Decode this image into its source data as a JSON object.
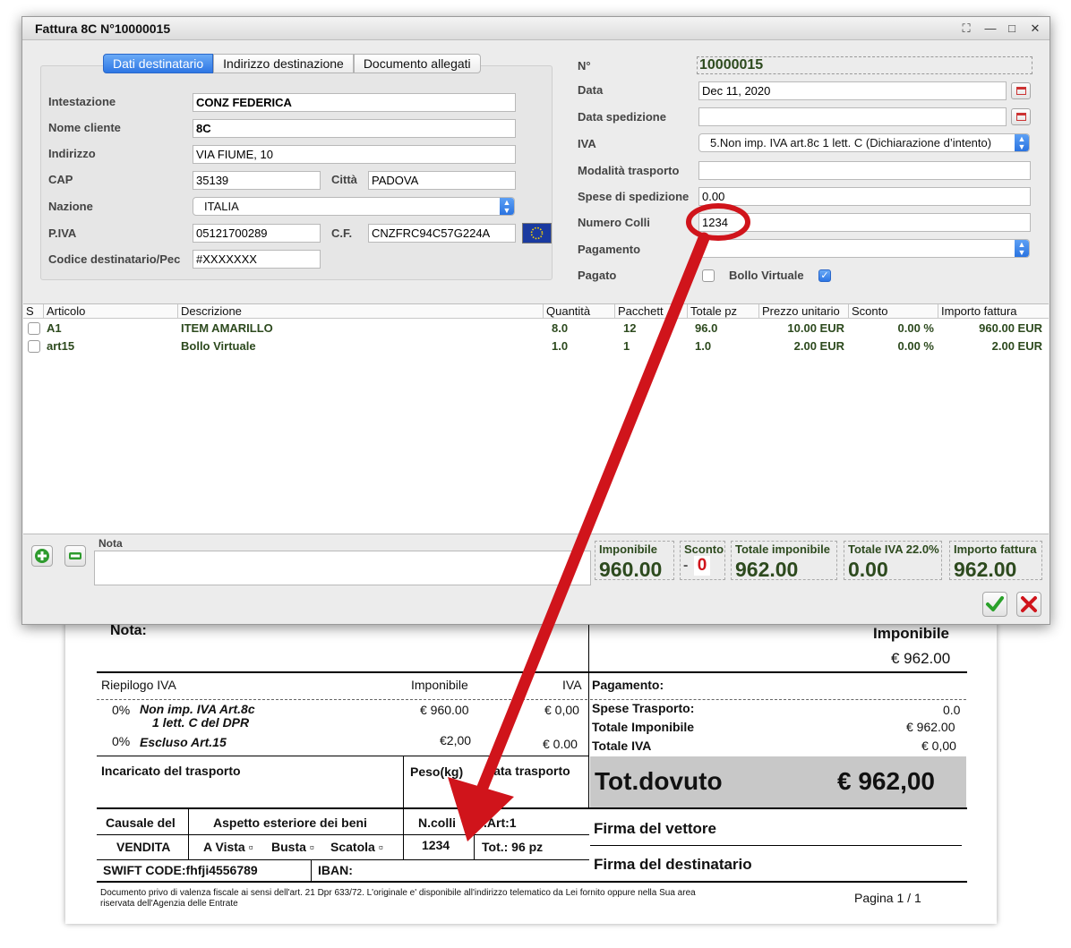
{
  "window": {
    "title": "Fattura 8C N°10000015",
    "controls": [
      "expand-icon",
      "minimize-icon",
      "maximize-icon",
      "close-icon"
    ]
  },
  "tabs": [
    {
      "label": "Dati destinatario",
      "active": true
    },
    {
      "label": "Indirizzo destinazione",
      "active": false
    },
    {
      "label": "Documento allegati",
      "active": false
    }
  ],
  "recipient": {
    "intestazione_label": "Intestazione",
    "intestazione": "CONZ FEDERICA",
    "nome_cliente_label": "Nome cliente",
    "nome_cliente": "8C",
    "indirizzo_label": "Indirizzo",
    "indirizzo": "VIA FIUME, 10",
    "cap_label": "CAP",
    "cap": "35139",
    "citta_label": "Città",
    "citta": "PADOVA",
    "nazione_label": "Nazione",
    "nazione": "ITALIA",
    "piva_label": "P.IVA",
    "piva": "05121700289",
    "cf_label": "C.F.",
    "cf": "CNZFRC94C57G224A",
    "codice_label": "Codice destinatario/Pec",
    "codice": "#XXXXXXX"
  },
  "invoice": {
    "numero_label": "N°",
    "numero": "10000015",
    "data_label": "Data",
    "data": "Dec 11, 2020",
    "data_spedizione_label": "Data spedizione",
    "data_spedizione": "",
    "iva_label": "IVA",
    "iva": "5.Non imp. IVA art.8c 1 lett. C (Dichiarazione d’intento)",
    "modalita_label": "Modalità trasporto",
    "modalita": "",
    "spese_label": "Spese di spedizione",
    "spese": "0.00",
    "colli_label": "Numero Colli",
    "colli": "1234",
    "pagamento_label": "Pagamento",
    "pagamento": "",
    "pagato_label": "Pagato",
    "pagato": false,
    "bollo_label": "Bollo Virtuale",
    "bollo": true
  },
  "table": {
    "headers": [
      "S",
      "Articolo",
      "Descrizione",
      "Quantità",
      "Pacchett",
      "Totale pz",
      "Prezzo unitario",
      "Sconto",
      "Importo fattura"
    ],
    "rows": [
      {
        "articolo": "A1",
        "descrizione": "ITEM AMARILLO",
        "quantita": "8.0",
        "pacchetti": "12",
        "totale_pz": "96.0",
        "prezzo": "10.00 EUR",
        "sconto": "0.00 %",
        "importo": "960.00 EUR"
      },
      {
        "articolo": "art15",
        "descrizione": "Bollo Virtuale",
        "quantita": "1.0",
        "pacchetti": "1",
        "totale_pz": "1.0",
        "prezzo": "2.00 EUR",
        "sconto": "0.00 %",
        "importo": "2.00 EUR"
      }
    ]
  },
  "footer": {
    "nota_label": "Nota",
    "nota": "",
    "imponibile_label": "Imponibile",
    "imponibile": "960.00",
    "sconto_label": "Sconto",
    "sconto_sign": "-",
    "sconto": "0",
    "totale_imponibile_label": "Totale imponibile",
    "totale_imponibile": "962.00",
    "totale_iva_label": "Totale IVA 22.0%",
    "totale_iva": "0.00",
    "importo_label": "Importo fattura",
    "importo": "962.00"
  },
  "printed": {
    "nota_label": "Nota:",
    "imponibile_label": "Imponibile",
    "imponibile": "€ 962.00",
    "riepilogo_label": "Riepilogo IVA",
    "col_imponibile": "Imponibile",
    "col_iva": "IVA",
    "row1_pct": "0%",
    "row1_desc1": "Non imp. IVA Art.8c",
    "row1_desc2": "1 lett. C del DPR",
    "row1_imp": "€ 960.00",
    "row1_iva": "€ 0,00",
    "row2_pct": "0%",
    "row2_desc": "Escluso Art.15",
    "row2_imp": "€2,00",
    "row2_iva": "€ 0.00",
    "pagamento_label": "Pagamento:",
    "spese_label": "Spese Trasporto:",
    "spese": "0.0",
    "tot_imponibile_label": "Totale Imponibile",
    "tot_imponibile": "€ 962.00",
    "tot_iva_label": "Totale IVA",
    "tot_iva": "€ 0,00",
    "tot_dovuto_label": "Tot.dovuto",
    "tot_dovuto": "€ 962,00",
    "incaricato_label": "Incaricato del trasporto",
    "peso_label": "Peso(kg)",
    "data_trasporto_label": "Data trasporto",
    "causale_label": "Causale del",
    "causale": "VENDITA",
    "aspetto_label": "Aspetto esteriore dei beni",
    "a_vista": "A Vista ▫",
    "busta": "Busta ▫",
    "scatola": "Scatola ▫",
    "ncolli_label": "N.colli",
    "ncolli": "1234",
    "tart_label": "T.Art:",
    "tart": "1",
    "tot_label": "Tot.:",
    "tot": "96 pz",
    "swift_label": "SWIFT CODE:",
    "swift": "fhfji4556789",
    "iban_label": "IBAN:",
    "firma_vettore": "Firma del vettore",
    "firma_destinatario": "Firma del destinatario",
    "disclaimer1": "Documento privo di valenza fiscale ai sensi dell'art. 21 Dpr 633/72. L'originale e' disponibile all'indirizzo telematico da Lei fornito oppure nella Sua area",
    "disclaimer2": "riservata dell'Agenzia delle Entrate",
    "pagina": "Pagina 1 / 1"
  },
  "colors": {
    "accent": "#2d76e4",
    "value_green": "#2d4a1e",
    "annotation_red": "#d0141b",
    "tot_dovuto_bg": "#c8c8c8"
  }
}
